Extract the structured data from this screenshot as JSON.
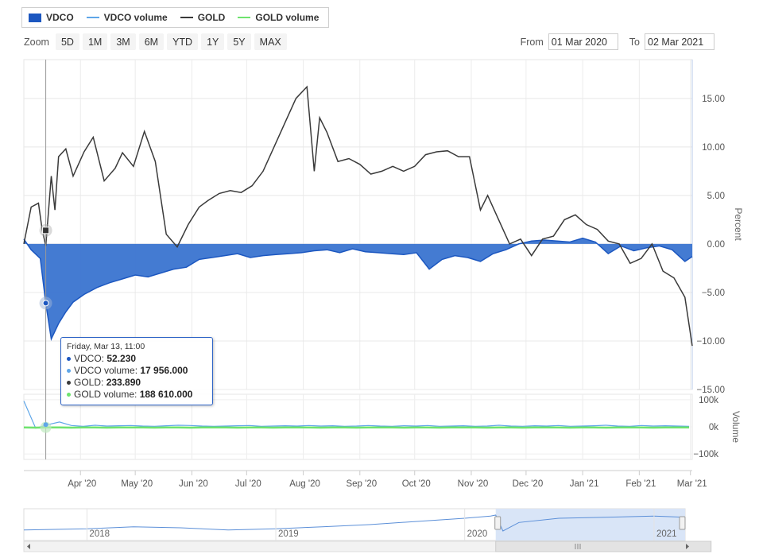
{
  "legend": {
    "items": [
      {
        "label": "VDCO",
        "color": "#1c57c0",
        "kind": "box"
      },
      {
        "label": "VDCO volume",
        "color": "#5fa6e8",
        "kind": "line"
      },
      {
        "label": "GOLD",
        "color": "#3a3a3a",
        "kind": "line"
      },
      {
        "label": "GOLD volume",
        "color": "#6ee36e",
        "kind": "line"
      }
    ]
  },
  "zoom": {
    "label": "Zoom",
    "buttons": [
      "5D",
      "1M",
      "3M",
      "6M",
      "YTD",
      "1Y",
      "5Y",
      "MAX"
    ]
  },
  "range": {
    "from_label": "From",
    "from_value": "01 Mar 2020",
    "to_label": "To",
    "to_value": "02 Mar 2021"
  },
  "tooltip": {
    "title": "Friday, Mar 13, 11:00",
    "rows": [
      {
        "label": "VDCO:",
        "value": "52.230",
        "color": "#1c57c0"
      },
      {
        "label": "VDCO volume:",
        "value": "17 956.000",
        "color": "#5fa6e8"
      },
      {
        "label": "GOLD:",
        "value": "233.890",
        "color": "#3a3a3a"
      },
      {
        "label": "GOLD volume:",
        "value": "188 610.000",
        "color": "#6ee36e"
      }
    ]
  },
  "colors": {
    "vdco": "#1c57c0",
    "vdco_fill": "#3a74d0",
    "gold": "#3a3a3a",
    "vdco_volume": "#5fa6e8",
    "gold_volume": "#6ee36e",
    "navigator_fill": "#d9e5f7"
  },
  "chart_data": {
    "type": "line",
    "x_tick_labels": [
      "Apr '20",
      "May '20",
      "Jun '20",
      "Jul '20",
      "Aug '20",
      "Sep '20",
      "Oct '20",
      "Nov '20",
      "Dec '20",
      "Jan '21",
      "Feb '21",
      "Mar '21"
    ],
    "main_axis": {
      "label": "Percent",
      "ticks": [
        "15.00",
        "10.00",
        "5.00",
        "0.00",
        "−5.00",
        "−10.00",
        "−15.00"
      ],
      "tick_values": [
        15,
        10,
        5,
        0,
        -5,
        -10,
        -15
      ],
      "ylim": [
        -15,
        19
      ]
    },
    "volume_axis": {
      "label": "Volume",
      "ticks": [
        "100k",
        "0k",
        "−100k"
      ],
      "tick_values": [
        100000,
        0,
        -100000
      ],
      "ylim": [
        -120000,
        120000
      ]
    },
    "navigator_labels": [
      "2018",
      "2019",
      "2020",
      "2021"
    ],
    "series": [
      {
        "name": "VDCO",
        "x": [
          "2020-03-01",
          "2020-03-05",
          "2020-03-10",
          "2020-03-13",
          "2020-03-16",
          "2020-03-20",
          "2020-03-24",
          "2020-03-28",
          "2020-04-03",
          "2020-04-10",
          "2020-04-17",
          "2020-04-24",
          "2020-05-01",
          "2020-05-08",
          "2020-05-15",
          "2020-05-22",
          "2020-05-29",
          "2020-06-05",
          "2020-06-12",
          "2020-06-19",
          "2020-06-26",
          "2020-07-03",
          "2020-07-10",
          "2020-07-17",
          "2020-07-24",
          "2020-07-31",
          "2020-08-07",
          "2020-08-14",
          "2020-08-21",
          "2020-08-28",
          "2020-09-04",
          "2020-09-11",
          "2020-09-18",
          "2020-09-25",
          "2020-10-02",
          "2020-10-09",
          "2020-10-16",
          "2020-10-23",
          "2020-10-30",
          "2020-11-06",
          "2020-11-13",
          "2020-11-20",
          "2020-11-27",
          "2020-12-04",
          "2020-12-11",
          "2020-12-18",
          "2020-12-25",
          "2021-01-01",
          "2021-01-08",
          "2021-01-15",
          "2021-01-22",
          "2021-01-29",
          "2021-02-05",
          "2021-02-12",
          "2021-02-19",
          "2021-02-26",
          "2021-03-02"
        ],
        "values": [
          0.5,
          -0.6,
          -1.5,
          -6.1,
          -9.8,
          -8.2,
          -7.0,
          -6.0,
          -5.2,
          -4.5,
          -4.0,
          -3.6,
          -3.2,
          -3.4,
          -3.0,
          -2.6,
          -2.4,
          -1.6,
          -1.4,
          -1.2,
          -1.0,
          -1.4,
          -1.2,
          -1.1,
          -1.0,
          -0.9,
          -0.7,
          -0.6,
          -0.9,
          -0.5,
          -0.8,
          -0.9,
          -1.0,
          -1.1,
          -0.9,
          -2.6,
          -1.6,
          -1.2,
          -1.4,
          -1.8,
          -1.0,
          -0.6,
          0.0,
          0.3,
          0.4,
          0.3,
          0.2,
          0.6,
          0.2,
          -1.0,
          -0.2,
          -0.7,
          -0.4,
          -0.2,
          -0.6,
          -1.8,
          -1.3
        ]
      },
      {
        "name": "GOLD",
        "x": [
          "2020-03-01",
          "2020-03-05",
          "2020-03-09",
          "2020-03-11",
          "2020-03-13",
          "2020-03-16",
          "2020-03-18",
          "2020-03-20",
          "2020-03-24",
          "2020-03-28",
          "2020-04-03",
          "2020-04-08",
          "2020-04-14",
          "2020-04-20",
          "2020-04-24",
          "2020-04-30",
          "2020-05-06",
          "2020-05-12",
          "2020-05-18",
          "2020-05-24",
          "2020-05-30",
          "2020-06-05",
          "2020-06-10",
          "2020-06-16",
          "2020-06-22",
          "2020-06-28",
          "2020-07-04",
          "2020-07-10",
          "2020-07-16",
          "2020-07-22",
          "2020-07-28",
          "2020-08-03",
          "2020-08-07",
          "2020-08-10",
          "2020-08-14",
          "2020-08-20",
          "2020-08-26",
          "2020-09-01",
          "2020-09-07",
          "2020-09-13",
          "2020-09-19",
          "2020-09-25",
          "2020-10-01",
          "2020-10-07",
          "2020-10-13",
          "2020-10-19",
          "2020-10-25",
          "2020-10-31",
          "2020-11-06",
          "2020-11-10",
          "2020-11-16",
          "2020-11-22",
          "2020-11-28",
          "2020-12-04",
          "2020-12-10",
          "2020-12-16",
          "2020-12-22",
          "2020-12-28",
          "2021-01-03",
          "2021-01-09",
          "2021-01-15",
          "2021-01-21",
          "2021-01-27",
          "2021-02-02",
          "2021-02-08",
          "2021-02-14",
          "2021-02-20",
          "2021-02-26",
          "2021-03-02"
        ],
        "values": [
          0.0,
          3.8,
          4.2,
          1.5,
          -0.2,
          7.0,
          3.5,
          9.0,
          9.8,
          7.0,
          9.5,
          11.0,
          6.5,
          7.8,
          9.4,
          8.0,
          11.6,
          8.5,
          1.0,
          -0.3,
          2.0,
          3.8,
          4.5,
          5.2,
          5.5,
          5.3,
          6.0,
          7.5,
          10.0,
          12.5,
          15.0,
          16.2,
          7.5,
          13.0,
          11.5,
          8.5,
          8.8,
          8.2,
          7.2,
          7.5,
          8.0,
          7.5,
          8.0,
          9.2,
          9.5,
          9.6,
          9.0,
          9.0,
          3.5,
          5.0,
          2.5,
          0.0,
          0.5,
          -1.2,
          0.5,
          0.8,
          2.5,
          3.0,
          2.0,
          1.5,
          0.3,
          0.0,
          -2.0,
          -1.5,
          0.0,
          -2.8,
          -3.5,
          -5.5,
          -10.5
        ]
      },
      {
        "name": "VDCO volume",
        "values": [
          95000,
          -5000,
          8000,
          18000,
          5000,
          2000,
          6000,
          3000,
          4000,
          5000,
          3000,
          2000,
          4000,
          6000,
          5000,
          3000,
          2000,
          3000,
          4000,
          5000,
          2000,
          3000,
          4000,
          3000,
          5000,
          3000,
          4000,
          2000,
          3000,
          5000,
          3000,
          2000,
          4000,
          3000,
          5000,
          2000,
          3000,
          4000,
          2000,
          3000,
          6000,
          3000,
          2000,
          4000,
          3000,
          5000,
          2000,
          3000,
          4000,
          6000,
          3000,
          2000,
          5000,
          3000,
          4000,
          3000,
          2000
        ]
      },
      {
        "name": "GOLD volume",
        "values": [
          -2000,
          -3000,
          -2000,
          -2000,
          -3000,
          -2000,
          -2000,
          -3000,
          -2000,
          -2000,
          -2000,
          -3000,
          -2000,
          -2000,
          -3000,
          -2000,
          -2000,
          -2000,
          -3000,
          -2000,
          -2000,
          -3000,
          -2000,
          -2000,
          -2000,
          -3000,
          -2000,
          -2000,
          -3000,
          -2000,
          -2000,
          -2000,
          -3000,
          -2000,
          -2000,
          -3000,
          -2000,
          -2000,
          -2000,
          -3000,
          -2000,
          -2000,
          -3000,
          -2000,
          -2000,
          -2000,
          -3000,
          -2000,
          -2000,
          -3000,
          -2000,
          -2000,
          -2000,
          -3000,
          -2000,
          -2000,
          -2000
        ]
      }
    ],
    "navigator": {
      "x": [
        "2017-09-01",
        "2018-01-01",
        "2018-04-01",
        "2018-07-01",
        "2018-10-01",
        "2019-01-01",
        "2019-04-01",
        "2019-07-01",
        "2019-10-01",
        "2020-01-01",
        "2020-02-20",
        "2020-03-01",
        "2020-03-15",
        "2020-04-15",
        "2020-07-01",
        "2020-10-01",
        "2021-01-01",
        "2021-03-02"
      ],
      "values": [
        95,
        96,
        98,
        97,
        95,
        96,
        98,
        100,
        103,
        106,
        108,
        109,
        94,
        102,
        106,
        107,
        108,
        107
      ]
    }
  }
}
